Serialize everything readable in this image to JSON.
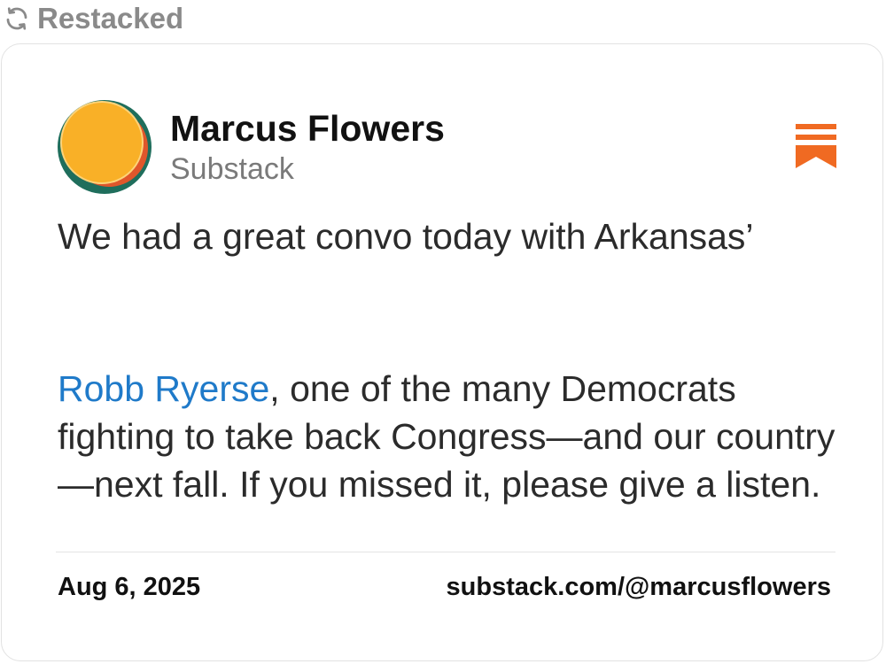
{
  "repost_banner": {
    "icon": "refresh-icon",
    "label": "Restacked"
  },
  "post": {
    "author": {
      "name": "Marcus Flowers",
      "platform": "Substack",
      "avatar_colors": [
        "#f9b027",
        "#1f6e5c",
        "#e0562b",
        "#8fa9d8"
      ]
    },
    "bookmark_icon": "bookmark-icon",
    "bookmark_color": "#f06a22",
    "paragraph_1": "We had a great convo today with Arkansas’",
    "mention": "Robb Ryerse",
    "paragraph_2_rest": ", one of the many Democrats fighting to take back Congress—and our country—next fall. If you missed it, please give a listen.",
    "mention_color": "#1f7ac9",
    "date": "Aug 6, 2025",
    "profile_url": "substack.com/@marcusflowers"
  }
}
